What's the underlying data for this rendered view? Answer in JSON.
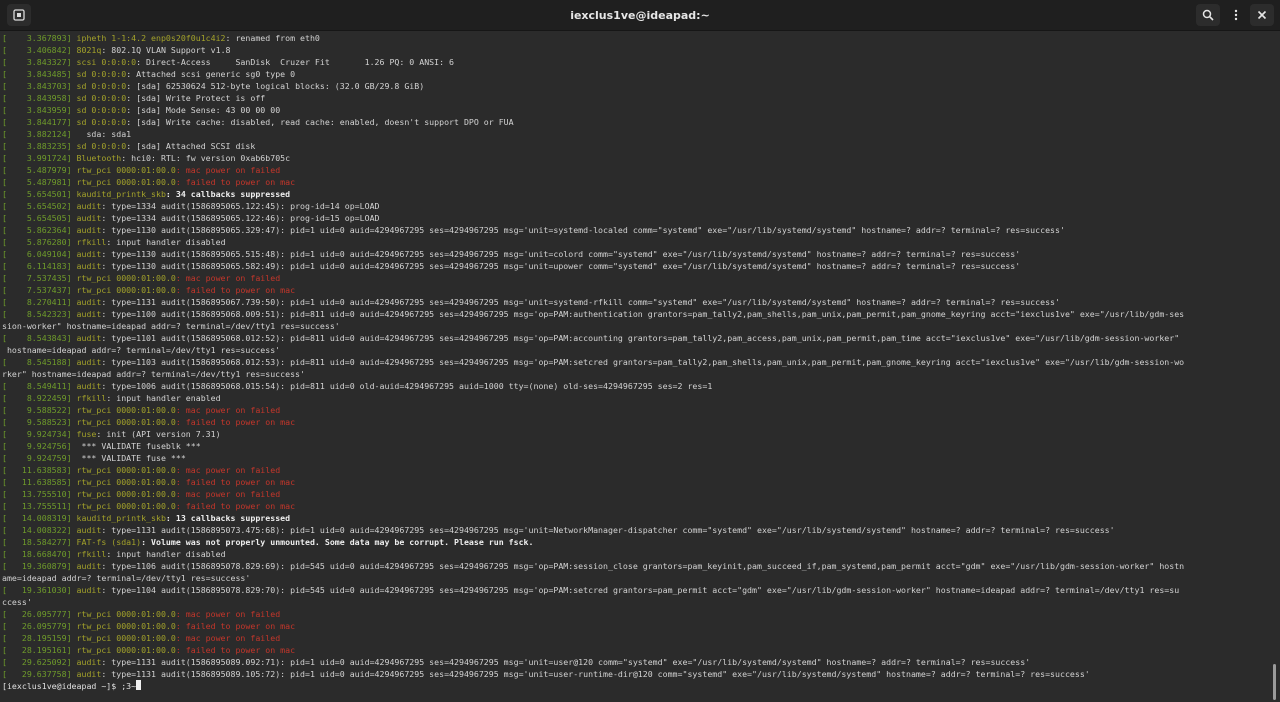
{
  "window": {
    "title": "iexclus1ve@ideapad:~",
    "left_icon": "new-tab-icon",
    "search_icon": "search-icon",
    "menu_icon": "kebab-menu-icon",
    "close_icon": "close-icon"
  },
  "colors": {
    "background": "#2b2b2b",
    "timestamp": "#6f9c2b",
    "source": "#a3a22a",
    "error": "#c4362b",
    "text": "#d3d3d3"
  },
  "lines": [
    {
      "ts": "[    3.367893]",
      "src": "ipheth 1-1:4.2 enp0s20f0u1c4i2",
      "msg": ": renamed from eth0"
    },
    {
      "ts": "[    3.406842]",
      "src": "8021q",
      "msg": ": 802.1Q VLAN Support v1.8"
    },
    {
      "ts": "[    3.843327]",
      "src": "scsi 0:0:0:0",
      "msg": ": Direct-Access     SanDisk  Cruzer Fit       1.26 PQ: 0 ANSI: 6"
    },
    {
      "ts": "[    3.843485]",
      "src": "sd 0:0:0:0",
      "msg": ": Attached scsi generic sg0 type 0"
    },
    {
      "ts": "[    3.843703]",
      "src": "sd 0:0:0:0",
      "msg": ": [sda] 62530624 512-byte logical blocks: (32.0 GB/29.8 GiB)"
    },
    {
      "ts": "[    3.843958]",
      "src": "sd 0:0:0:0",
      "msg": ": [sda] Write Protect is off"
    },
    {
      "ts": "[    3.843959]",
      "src": "sd 0:0:0:0",
      "msg": ": [sda] Mode Sense: 43 00 00 00"
    },
    {
      "ts": "[    3.844177]",
      "src": "sd 0:0:0:0",
      "msg": ": [sda] Write cache: disabled, read cache: enabled, doesn't support DPO or FUA"
    },
    {
      "ts": "[    3.882124]",
      "src": "",
      "msg": "  sda: sda1"
    },
    {
      "ts": "[    3.883235]",
      "src": "sd 0:0:0:0",
      "msg": ": [sda] Attached SCSI disk"
    },
    {
      "ts": "[    3.991724]",
      "src": "Bluetooth",
      "msg": ": hci0: RTL: fw version 0xab6b705c"
    },
    {
      "ts": "[    5.487979]",
      "src": "rtw_pci 0000:01:00.0",
      "msg": ": mac power on failed",
      "style": "err"
    },
    {
      "ts": "[    5.487981]",
      "src": "rtw_pci 0000:01:00.0",
      "msg": ": failed to power on mac",
      "style": "err"
    },
    {
      "ts": "[    5.654501]",
      "src": "kauditd_printk_skb",
      "msg": ": 34 callbacks suppressed",
      "style": "bold"
    },
    {
      "ts": "[    5.654502]",
      "src": "audit",
      "msg": ": type=1334 audit(1586895065.122:45): prog-id=14 op=LOAD"
    },
    {
      "ts": "[    5.654505]",
      "src": "audit",
      "msg": ": type=1334 audit(1586895065.122:46): prog-id=15 op=LOAD"
    },
    {
      "ts": "[    5.862364]",
      "src": "audit",
      "msg": ": type=1130 audit(1586895065.329:47): pid=1 uid=0 auid=4294967295 ses=4294967295 msg='unit=systemd-localed comm=\"systemd\" exe=\"/usr/lib/systemd/systemd\" hostname=? addr=? terminal=? res=success'"
    },
    {
      "ts": "[    5.876280]",
      "src": "rfkill",
      "msg": ": input handler disabled"
    },
    {
      "ts": "[    6.049104]",
      "src": "audit",
      "msg": ": type=1130 audit(1586895065.515:48): pid=1 uid=0 auid=4294967295 ses=4294967295 msg='unit=colord comm=\"systemd\" exe=\"/usr/lib/systemd/systemd\" hostname=? addr=? terminal=? res=success'"
    },
    {
      "ts": "[    6.114183]",
      "src": "audit",
      "msg": ": type=1130 audit(1586895065.582:49): pid=1 uid=0 auid=4294967295 ses=4294967295 msg='unit=upower comm=\"systemd\" exe=\"/usr/lib/systemd/systemd\" hostname=? addr=? terminal=? res=success'"
    },
    {
      "ts": "[    7.537435]",
      "src": "rtw_pci 0000:01:00.0",
      "msg": ": mac power on failed",
      "style": "err"
    },
    {
      "ts": "[    7.537437]",
      "src": "rtw_pci 0000:01:00.0",
      "msg": ": failed to power on mac",
      "style": "err"
    },
    {
      "ts": "[    8.270411]",
      "src": "audit",
      "msg": ": type=1131 audit(1586895067.739:50): pid=1 uid=0 auid=4294967295 ses=4294967295 msg='unit=systemd-rfkill comm=\"systemd\" exe=\"/usr/lib/systemd/systemd\" hostname=? addr=? terminal=? res=success'"
    },
    {
      "ts": "[    8.542323]",
      "src": "audit",
      "msg": ": type=1100 audit(1586895068.009:51): pid=811 uid=0 auid=4294967295 ses=4294967295 msg='op=PAM:authentication grantors=pam_tally2,pam_shells,pam_unix,pam_permit,pam_gnome_keyring acct=\"iexclus1ve\" exe=\"/usr/lib/gdm-ses"
    },
    {
      "ts": "",
      "src": "",
      "msg": "sion-worker\" hostname=ideapad addr=? terminal=/dev/tty1 res=success'"
    },
    {
      "ts": "[    8.543843]",
      "src": "audit",
      "msg": ": type=1101 audit(1586895068.012:52): pid=811 uid=0 auid=4294967295 ses=4294967295 msg='op=PAM:accounting grantors=pam_tally2,pam_access,pam_unix,pam_permit,pam_time acct=\"iexclus1ve\" exe=\"/usr/lib/gdm-session-worker\""
    },
    {
      "ts": "",
      "src": "",
      "msg": " hostname=ideapad addr=? terminal=/dev/tty1 res=success'"
    },
    {
      "ts": "[    8.545188]",
      "src": "audit",
      "msg": ": type=1103 audit(1586895068.012:53): pid=811 uid=0 auid=4294967295 ses=4294967295 msg='op=PAM:setcred grantors=pam_tally2,pam_shells,pam_unix,pam_permit,pam_gnome_keyring acct=\"iexclus1ve\" exe=\"/usr/lib/gdm-session-wo"
    },
    {
      "ts": "",
      "src": "",
      "msg": "rker\" hostname=ideapad addr=? terminal=/dev/tty1 res=success'"
    },
    {
      "ts": "[    8.549411]",
      "src": "audit",
      "msg": ": type=1006 audit(1586895068.015:54): pid=811 uid=0 old-auid=4294967295 auid=1000 tty=(none) old-ses=4294967295 ses=2 res=1"
    },
    {
      "ts": "[    8.922459]",
      "src": "rfkill",
      "msg": ": input handler enabled"
    },
    {
      "ts": "[    9.588522]",
      "src": "rtw_pci 0000:01:00.0",
      "msg": ": mac power on failed",
      "style": "err"
    },
    {
      "ts": "[    9.588523]",
      "src": "rtw_pci 0000:01:00.0",
      "msg": ": failed to power on mac",
      "style": "err"
    },
    {
      "ts": "[    9.924734]",
      "src": "fuse",
      "msg": ": init (API version 7.31)"
    },
    {
      "ts": "[    9.924756]",
      "src": "",
      "msg": " *** VALIDATE fuseblk ***"
    },
    {
      "ts": "[    9.924759]",
      "src": "",
      "msg": " *** VALIDATE fuse ***"
    },
    {
      "ts": "[   11.638583]",
      "src": "rtw_pci 0000:01:00.0",
      "msg": ": mac power on failed",
      "style": "err"
    },
    {
      "ts": "[   11.638585]",
      "src": "rtw_pci 0000:01:00.0",
      "msg": ": failed to power on mac",
      "style": "err"
    },
    {
      "ts": "[   13.755510]",
      "src": "rtw_pci 0000:01:00.0",
      "msg": ": mac power on failed",
      "style": "err"
    },
    {
      "ts": "[   13.755511]",
      "src": "rtw_pci 0000:01:00.0",
      "msg": ": failed to power on mac",
      "style": "err"
    },
    {
      "ts": "[   14.008319]",
      "src": "kauditd_printk_skb",
      "msg": ": 13 callbacks suppressed",
      "style": "bold"
    },
    {
      "ts": "[   14.008322]",
      "src": "audit",
      "msg": ": type=1131 audit(1586895073.475:68): pid=1 uid=0 auid=4294967295 ses=4294967295 msg='unit=NetworkManager-dispatcher comm=\"systemd\" exe=\"/usr/lib/systemd/systemd\" hostname=? addr=? terminal=? res=success'"
    },
    {
      "ts": "[   18.584277]",
      "src": "FAT-fs (sda1)",
      "msg": ": Volume was not properly unmounted. Some data may be corrupt. Please run fsck.",
      "style": "bold"
    },
    {
      "ts": "[   18.668470]",
      "src": "rfkill",
      "msg": ": input handler disabled"
    },
    {
      "ts": "[   19.360879]",
      "src": "audit",
      "msg": ": type=1106 audit(1586895078.829:69): pid=545 uid=0 auid=4294967295 ses=4294967295 msg='op=PAM:session_close grantors=pam_keyinit,pam_succeed_if,pam_systemd,pam_permit acct=\"gdm\" exe=\"/usr/lib/gdm-session-worker\" hostn"
    },
    {
      "ts": "",
      "src": "",
      "msg": "ame=ideapad addr=? terminal=/dev/tty1 res=success'"
    },
    {
      "ts": "[   19.361030]",
      "src": "audit",
      "msg": ": type=1104 audit(1586895078.829:70): pid=545 uid=0 auid=4294967295 ses=4294967295 msg='op=PAM:setcred grantors=pam_permit acct=\"gdm\" exe=\"/usr/lib/gdm-session-worker\" hostname=ideapad addr=? terminal=/dev/tty1 res=su"
    },
    {
      "ts": "",
      "src": "",
      "msg": "ccess'"
    },
    {
      "ts": "[   26.095777]",
      "src": "rtw_pci 0000:01:00.0",
      "msg": ": mac power on failed",
      "style": "err"
    },
    {
      "ts": "[   26.095779]",
      "src": "rtw_pci 0000:01:00.0",
      "msg": ": failed to power on mac",
      "style": "err"
    },
    {
      "ts": "[   28.195159]",
      "src": "rtw_pci 0000:01:00.0",
      "msg": ": mac power on failed",
      "style": "err"
    },
    {
      "ts": "[   28.195161]",
      "src": "rtw_pci 0000:01:00.0",
      "msg": ": failed to power on mac",
      "style": "err"
    },
    {
      "ts": "[   29.625092]",
      "src": "audit",
      "msg": ": type=1131 audit(1586895089.092:71): pid=1 uid=0 auid=4294967295 ses=4294967295 msg='unit=user@120 comm=\"systemd\" exe=\"/usr/lib/systemd/systemd\" hostname=? addr=? terminal=? res=success'"
    },
    {
      "ts": "[   29.637758]",
      "src": "audit",
      "msg": ": type=1131 audit(1586895089.105:72): pid=1 uid=0 auid=4294967295 ses=4294967295 msg='unit=user-runtime-dir@120 comm=\"systemd\" exe=\"/usr/lib/systemd/systemd\" hostname=? addr=? terminal=? res=success'"
    }
  ],
  "prompt": {
    "text": "[iexclus1ve@ideapad ~]$ ;3~"
  }
}
